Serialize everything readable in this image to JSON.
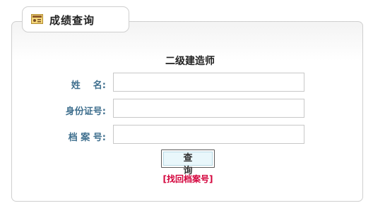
{
  "tab": {
    "title": "成绩查询",
    "icon": "id-card-icon"
  },
  "form": {
    "title": "二级建造师",
    "fields": [
      {
        "label": "姓    名:",
        "value": ""
      },
      {
        "label": "身份证号:",
        "value": ""
      },
      {
        "label": "档 案 号:",
        "value": ""
      }
    ],
    "submit_label": "查 询",
    "recover_link": "[找回档案号]"
  },
  "colors": {
    "label": "#3f6f8e",
    "link": "#d3003a",
    "button_fill": "#e9f7fb",
    "border": "#cfcfcf"
  }
}
